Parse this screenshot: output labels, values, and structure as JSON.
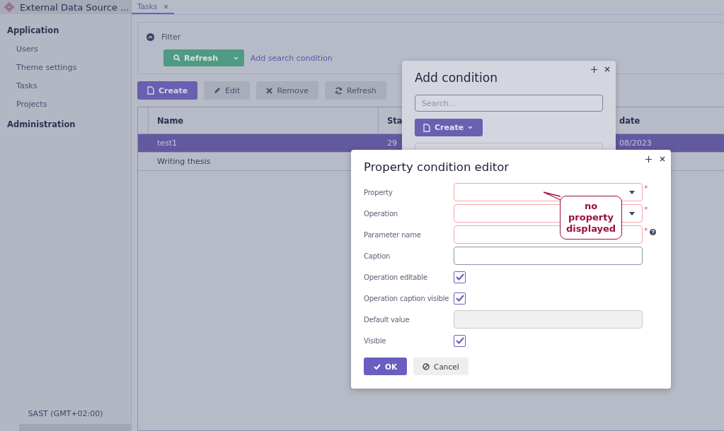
{
  "app": {
    "title": "External Data Source ..."
  },
  "sidebar": {
    "groups": [
      {
        "label": "Application",
        "items": [
          {
            "label": "Users"
          },
          {
            "label": "Theme settings"
          },
          {
            "label": "Tasks"
          },
          {
            "label": "Projects"
          }
        ]
      },
      {
        "label": "Administration"
      }
    ],
    "timezone": "SAST (GMT+02:00)"
  },
  "tabs": [
    {
      "label": "Tasks",
      "selected": true
    }
  ],
  "filter": {
    "label": "Filter",
    "expanded": true,
    "refresh_button": "Refresh",
    "add_condition_link": "Add search condition"
  },
  "toolbar": [
    {
      "label": "Create",
      "kind": "primary"
    },
    {
      "label": "Edit",
      "kind": "plain"
    },
    {
      "label": "Remove",
      "kind": "plain"
    },
    {
      "label": "Refresh",
      "kind": "plain"
    }
  ],
  "table": {
    "columns": [
      "Name",
      "Sta",
      "date"
    ],
    "rows": [
      {
        "cells": [
          "test1",
          "29",
          "08/2023"
        ],
        "selected": true
      },
      {
        "cells": [
          "Writing thesis"
        ],
        "selected": false
      }
    ]
  },
  "add_condition_dialog": {
    "title": "Add condition",
    "search_placeholder": "Search...",
    "create_button": "Create"
  },
  "editor_dialog": {
    "title": "Property condition editor",
    "fields": [
      {
        "label": "Property",
        "kind": "select",
        "required": true,
        "required_mark": "*"
      },
      {
        "label": "Operation",
        "kind": "select",
        "required": true,
        "required_mark": "*"
      },
      {
        "label": "Parameter name",
        "kind": "text",
        "required": true,
        "required_mark": "*",
        "help": true
      },
      {
        "label": "Caption",
        "kind": "text",
        "required": false
      },
      {
        "label": "Operation editable",
        "kind": "checkbox",
        "checked": true
      },
      {
        "label": "Operation caption visible",
        "kind": "checkbox",
        "checked": true
      },
      {
        "label": "Default value",
        "kind": "text",
        "required": false,
        "disabled": true
      },
      {
        "label": "Visible",
        "kind": "checkbox",
        "checked": true
      }
    ],
    "ok_button": "OK",
    "cancel_button": "Cancel"
  },
  "callout": {
    "text": "no property displayed"
  }
}
